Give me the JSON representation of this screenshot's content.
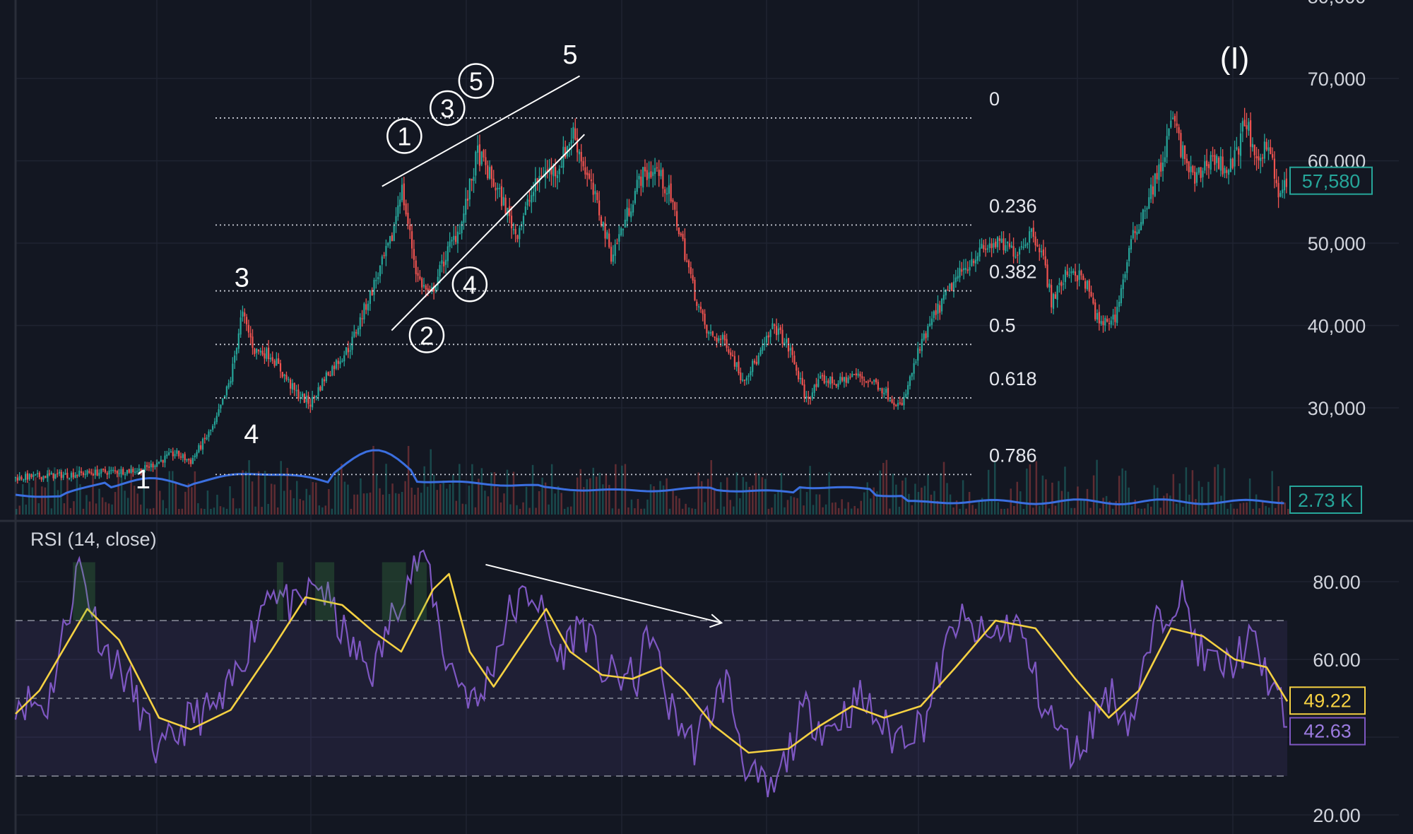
{
  "chart_data": [
    {
      "type": "candlestick",
      "panel": "price",
      "y_axis_ticks": [
        {
          "value": 30000,
          "label": "30,000"
        },
        {
          "value": 40000,
          "label": "40,000"
        },
        {
          "value": 50000,
          "label": "50,000"
        },
        {
          "value": 60000,
          "label": "60,000"
        },
        {
          "value": 70000,
          "label": "70,000"
        },
        {
          "value": 80000,
          "label": "80,000"
        }
      ],
      "ylim": [
        20000,
        84000
      ],
      "price_badge": {
        "label": "57,580",
        "value": 57580,
        "color": "#26a69a"
      },
      "volume_badge": {
        "label": "2.73 K",
        "color": "#26a69a"
      },
      "close_path": [
        [
          0,
          21500
        ],
        [
          40,
          22000
        ],
        [
          80,
          22500
        ],
        [
          100,
          24500
        ],
        [
          110,
          23500
        ],
        [
          125,
          28000
        ],
        [
          135,
          33500
        ],
        [
          142,
          41500
        ],
        [
          150,
          37000
        ],
        [
          160,
          36500
        ],
        [
          175,
          32000
        ],
        [
          185,
          30500
        ],
        [
          195,
          34000
        ],
        [
          210,
          37500
        ],
        [
          222,
          43500
        ],
        [
          236,
          50500
        ],
        [
          242,
          57000
        ],
        [
          252,
          46000
        ],
        [
          260,
          43500
        ],
        [
          270,
          48500
        ],
        [
          280,
          52500
        ],
        [
          290,
          61000
        ],
        [
          298,
          58000
        ],
        [
          306,
          55000
        ],
        [
          314,
          51000
        ],
        [
          322,
          55000
        ],
        [
          330,
          58500
        ],
        [
          340,
          59000
        ],
        [
          350,
          63500
        ],
        [
          358,
          58500
        ],
        [
          366,
          54000
        ],
        [
          374,
          48500
        ],
        [
          382,
          52500
        ],
        [
          392,
          58000
        ],
        [
          402,
          59000
        ],
        [
          410,
          56000
        ],
        [
          418,
          50500
        ],
        [
          426,
          44000
        ],
        [
          434,
          39000
        ],
        [
          446,
          38000
        ],
        [
          456,
          33500
        ],
        [
          466,
          36000
        ],
        [
          476,
          40000
        ],
        [
          486,
          37000
        ],
        [
          496,
          31000
        ],
        [
          506,
          33500
        ],
        [
          516,
          33000
        ],
        [
          526,
          34000
        ],
        [
          540,
          33000
        ],
        [
          556,
          30000
        ],
        [
          566,
          36500
        ],
        [
          576,
          41000
        ],
        [
          588,
          45000
        ],
        [
          602,
          48500
        ],
        [
          614,
          50000
        ],
        [
          628,
          49000
        ],
        [
          638,
          51500
        ],
        [
          644,
          49000
        ],
        [
          650,
          43000
        ],
        [
          662,
          47000
        ],
        [
          672,
          45000
        ],
        [
          680,
          40000
        ],
        [
          690,
          41000
        ],
        [
          700,
          50000
        ],
        [
          712,
          56000
        ],
        [
          720,
          60000
        ],
        [
          726,
          65500
        ],
        [
          732,
          61000
        ],
        [
          740,
          57500
        ],
        [
          750,
          60500
        ],
        [
          760,
          59000
        ],
        [
          766,
          60500
        ],
        [
          772,
          65500
        ],
        [
          778,
          59000
        ],
        [
          786,
          63000
        ],
        [
          792,
          55500
        ],
        [
          798,
          57580
        ]
      ],
      "fibonacci": [
        {
          "level": "0",
          "price": 65200
        },
        {
          "level": "0.236",
          "price": 52200
        },
        {
          "level": "0.382",
          "price": 44200
        },
        {
          "level": "0.5",
          "price": 37700
        },
        {
          "level": "0.618",
          "price": 31200
        },
        {
          "level": "0.786",
          "price": 21900
        }
      ],
      "wave_labels_plain": [
        {
          "text": "1",
          "x": 80,
          "price": 20200
        },
        {
          "text": "3",
          "x": 142,
          "price": 44700
        },
        {
          "text": "4",
          "x": 148,
          "price": 25700
        },
        {
          "text": "5",
          "x": 348,
          "price": 71800
        }
      ],
      "wave_labels_circled": [
        {
          "text": "1",
          "x": 244,
          "price": 63000,
          "size": "large"
        },
        {
          "text": "2",
          "x": 258,
          "price": 38800,
          "size": "large"
        },
        {
          "text": "3",
          "x": 271,
          "price": 66400,
          "size": "large"
        },
        {
          "text": "4",
          "x": 285,
          "price": 45000,
          "size": "large"
        },
        {
          "text": "5",
          "x": 289,
          "price": 69700,
          "size": "large"
        }
      ],
      "degree_label": {
        "text": "(I)",
        "x": 765,
        "price": 71200
      },
      "wedge_lines": [
        {
          "from": [
            230,
            56900
          ],
          "to": [
            354,
            70300
          ]
        },
        {
          "from": [
            236,
            39400
          ],
          "to": [
            357,
            63200
          ]
        }
      ]
    },
    {
      "type": "line",
      "panel": "rsi",
      "legend_label": "RSI (14, close)",
      "y_axis_ticks": [
        {
          "value": 20,
          "label": "20.00"
        },
        {
          "value": 40,
          "label": "40.00"
        },
        {
          "value": 60,
          "label": "60.00"
        },
        {
          "value": 80,
          "label": "80.00"
        }
      ],
      "ylim": [
        18,
        90
      ],
      "bands": {
        "upper": 70,
        "middle": 50,
        "lower": 30
      },
      "series": [
        {
          "name": "RSI",
          "color": "#7e57c2",
          "last_value": 42.63,
          "points": [
            [
              0,
              50
            ],
            [
              20,
              48
            ],
            [
              40,
              85
            ],
            [
              55,
              63
            ],
            [
              70,
              55
            ],
            [
              90,
              35
            ],
            [
              110,
              45
            ],
            [
              130,
              48
            ],
            [
              145,
              63
            ],
            [
              160,
              80
            ],
            [
              175,
              72
            ],
            [
              190,
              80
            ],
            [
              210,
              63
            ],
            [
              225,
              57
            ],
            [
              242,
              78
            ],
            [
              257,
              88
            ],
            [
              270,
              60
            ],
            [
              290,
              48
            ],
            [
              310,
              72
            ],
            [
              325,
              78
            ],
            [
              340,
              60
            ],
            [
              355,
              70
            ],
            [
              370,
              56
            ],
            [
              390,
              55
            ],
            [
              398,
              68
            ],
            [
              410,
              48
            ],
            [
              426,
              38
            ],
            [
              446,
              55
            ],
            [
              460,
              30
            ],
            [
              475,
              25
            ],
            [
              495,
              47
            ],
            [
              510,
              42
            ],
            [
              530,
              50
            ],
            [
              550,
              40
            ],
            [
              570,
              44
            ],
            [
              590,
              70
            ],
            [
              610,
              65
            ],
            [
              628,
              70
            ],
            [
              645,
              48
            ],
            [
              665,
              35
            ],
            [
              685,
              52
            ],
            [
              700,
              44
            ],
            [
              715,
              68
            ],
            [
              730,
              78
            ],
            [
              745,
              60
            ],
            [
              760,
              58
            ],
            [
              775,
              65
            ],
            [
              790,
              52
            ],
            [
              798,
              42.63
            ]
          ]
        },
        {
          "name": "RSI-based MA",
          "color": "#f5d142",
          "last_value": 49.22,
          "points": [
            [
              0,
              46
            ],
            [
              15,
              52
            ],
            [
              45,
              73
            ],
            [
              65,
              65
            ],
            [
              90,
              45
            ],
            [
              110,
              42
            ],
            [
              135,
              47
            ],
            [
              160,
              62
            ],
            [
              182,
              76
            ],
            [
              205,
              74
            ],
            [
              225,
              67
            ],
            [
              242,
              62
            ],
            [
              262,
              78
            ],
            [
              272,
              82
            ],
            [
              285,
              62
            ],
            [
              300,
              53
            ],
            [
              318,
              64
            ],
            [
              333,
              73
            ],
            [
              348,
              62
            ],
            [
              368,
              56
            ],
            [
              387,
              55
            ],
            [
              405,
              58
            ],
            [
              420,
              52
            ],
            [
              438,
              43
            ],
            [
              460,
              36
            ],
            [
              485,
              37
            ],
            [
              505,
              43
            ],
            [
              525,
              48
            ],
            [
              545,
              45
            ],
            [
              568,
              48
            ],
            [
              590,
              58
            ],
            [
              615,
              70
            ],
            [
              640,
              68
            ],
            [
              665,
              55
            ],
            [
              686,
              45
            ],
            [
              705,
              52
            ],
            [
              725,
              68
            ],
            [
              745,
              66
            ],
            [
              765,
              60
            ],
            [
              785,
              58
            ],
            [
              798,
              49.22
            ]
          ]
        }
      ],
      "divergence_arrow": {
        "from": [
          295,
          84.4
        ],
        "to": [
          443,
          69.4
        ]
      }
    }
  ]
}
